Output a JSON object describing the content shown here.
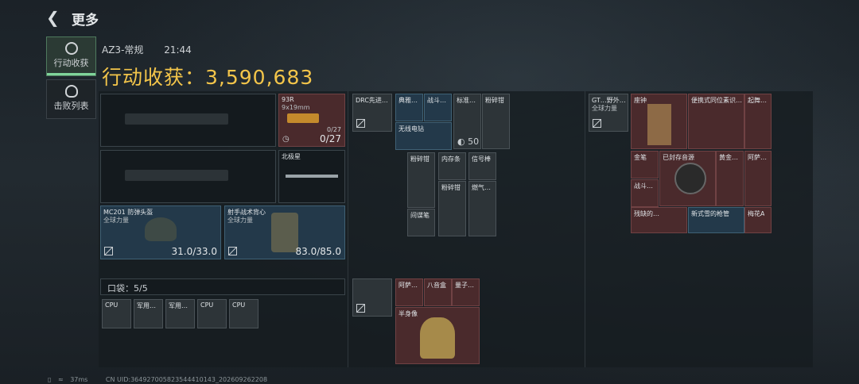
{
  "header": {
    "back_icon": "back-arrow-icon",
    "title": "更多"
  },
  "tabs": [
    {
      "label": "行动收获",
      "icon": "target-icon",
      "active": true
    },
    {
      "label": "击败列表",
      "icon": "alien-head-icon",
      "active": false
    }
  ],
  "session": {
    "map": "AZ3-常规",
    "time": "21:44"
  },
  "gain": {
    "label": "行动收获：",
    "value": "3,590,683"
  },
  "loadout": {
    "weapon_ammo": {
      "name": "93R",
      "sub": "9x19mm",
      "count_small": "0/27",
      "count": "0/27"
    },
    "melee": {
      "name": "北极星"
    },
    "helmet": {
      "name": "MC201 防弹头盔",
      "faction": "全球力量",
      "durability": "31.0/33.0"
    },
    "armor": {
      "name": "射手战术背心",
      "faction": "全球力量",
      "durability": "83.0/85.0"
    }
  },
  "pocket": {
    "label": "口袋：",
    "count": "5/5",
    "items": [
      "CPU",
      "军用…",
      "军用…",
      "CPU",
      "CPU"
    ]
  },
  "rig": {
    "items": [
      "DRC先进…",
      "典雅…",
      "战斗…",
      "标准…",
      "粉碎钳",
      "无线电钻",
      "50",
      "粉碎钳",
      "内存条",
      "信号棒",
      "粉碎钳",
      "燃气…",
      "间谍笔"
    ]
  },
  "backpack_small": {
    "items": [
      "阿萨…",
      "八音盒",
      "量子…",
      "半身像"
    ]
  },
  "backpack": {
    "bag": {
      "name": "GT…野外…",
      "faction": "全球力量"
    },
    "items": [
      "座钟",
      "便携式同位素识…",
      "起舞…",
      "金笔",
      "已封存音源",
      "黄金…",
      "阿萨…",
      "战斗…",
      "残缺的…",
      "新式雪的枪管",
      "梅花A"
    ]
  },
  "status": {
    "ping": "37ms",
    "uid": "CN UID:364927005823544410143_202609262208"
  }
}
